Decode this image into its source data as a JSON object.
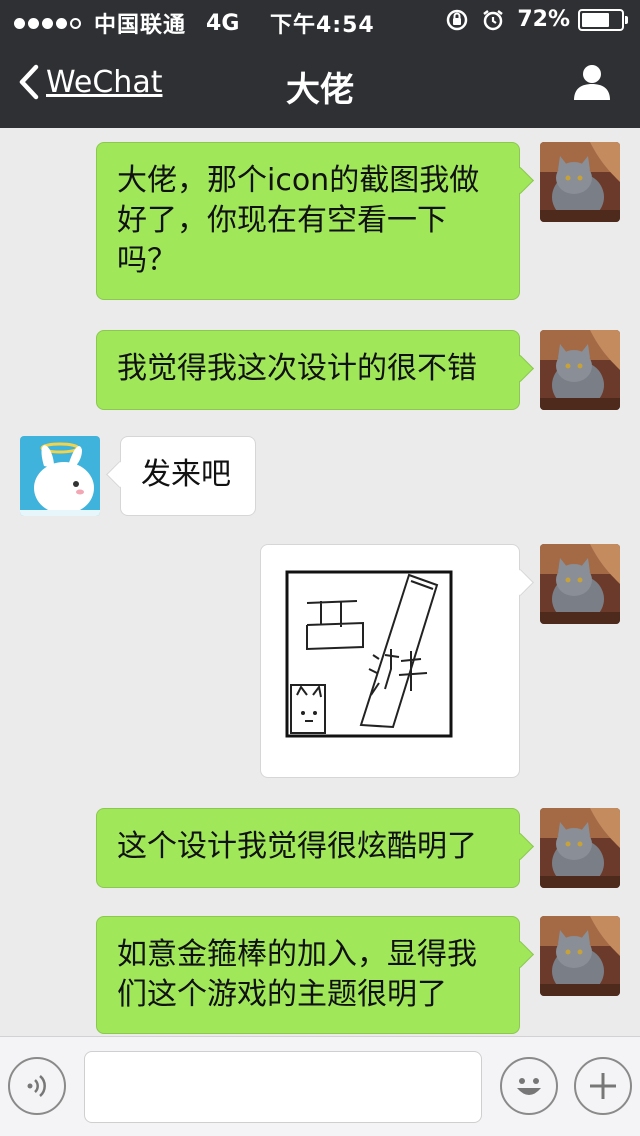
{
  "status_bar": {
    "carrier": "中国联通",
    "network": "4G",
    "time": "下午4:54",
    "battery": "72%",
    "battery_level": 0.72,
    "signal_bars_filled": 4,
    "signal_bars_total": 5
  },
  "nav": {
    "back_label": "WeChat",
    "title": "大佬",
    "right_icon": "profile-icon"
  },
  "messages": [
    {
      "sender": "me",
      "type": "text",
      "text": "大佬，那个icon的截图我做好了，你现在有空看一下吗？"
    },
    {
      "sender": "me",
      "type": "text",
      "text": "我觉得我这次设计的很不错"
    },
    {
      "sender": "other",
      "type": "text",
      "text": "发来吧"
    },
    {
      "sender": "me",
      "type": "image",
      "image_text": "西游"
    },
    {
      "sender": "me",
      "type": "text",
      "text": "这个设计我觉得很炫酷明了"
    },
    {
      "sender": "me",
      "type": "text",
      "text": "如意金箍棒的加入，显得我们这个游戏的主题很明了"
    }
  ],
  "input_bar": {
    "voice_icon": "voice-icon",
    "emoji_icon": "emoji-icon",
    "add_icon": "plus-icon",
    "text_value": ""
  },
  "colors": {
    "header_bg": "#2e3033",
    "chat_bg": "#ebebeb",
    "outgoing_bubble": "#a0e75a",
    "incoming_bubble": "#ffffff"
  }
}
